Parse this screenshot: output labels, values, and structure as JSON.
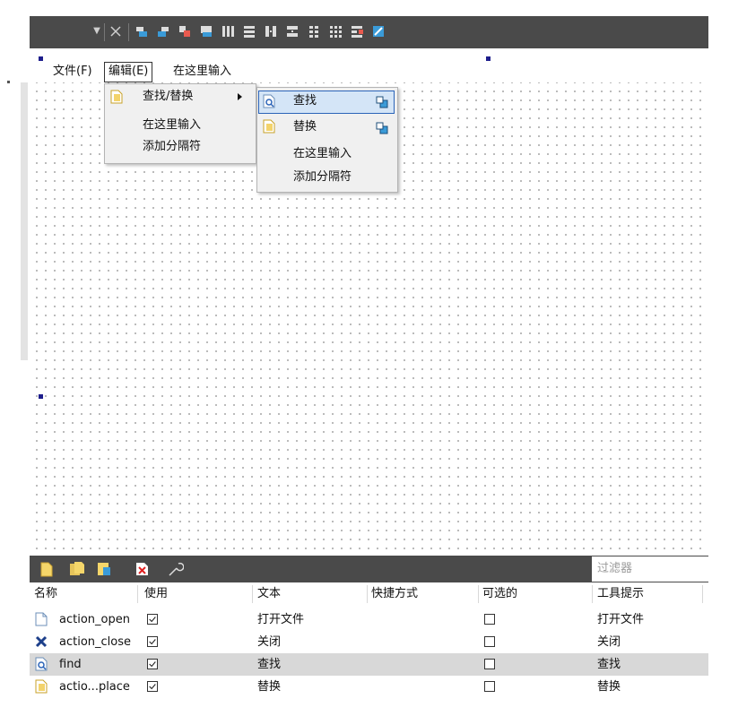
{
  "toolbar": {
    "buttons": [
      "close-x",
      "align-left",
      "align-right",
      "align-top",
      "align-bottom",
      "layout-horizontal",
      "layout-vertical",
      "layout-h-splitter",
      "layout-v-splitter",
      "layout-form",
      "layout-grid",
      "break-layout",
      "adjust-size"
    ]
  },
  "menubar": {
    "file": "文件(F)",
    "edit": "编辑(E)",
    "type_here": "在这里输入"
  },
  "edit_menu": {
    "find_replace": "查找/替换",
    "type_here": "在这里输入",
    "add_separator": "添加分隔符"
  },
  "submenu": {
    "find": "查找",
    "replace": "替换",
    "type_here": "在这里输入",
    "add_separator": "添加分隔符"
  },
  "action_editor": {
    "filter_placeholder": "过滤器",
    "headers": [
      "名称",
      "使用",
      "文本",
      "快捷方式",
      "可选的",
      "工具提示"
    ],
    "rows": [
      {
        "name": "action_open",
        "used": true,
        "text": "打开文件",
        "shortcut": "",
        "checkable": false,
        "tooltip": "打开文件",
        "icon": "file-icon"
      },
      {
        "name": "action_close",
        "used": true,
        "text": "关闭",
        "shortcut": "",
        "checkable": false,
        "tooltip": "关闭",
        "icon": "close-x-icon"
      },
      {
        "name": "find",
        "used": true,
        "text": "查找",
        "shortcut": "",
        "checkable": false,
        "tooltip": "查找",
        "icon": "find-icon"
      },
      {
        "name": "actio...place",
        "used": true,
        "text": "替换",
        "shortcut": "",
        "checkable": false,
        "tooltip": "替换",
        "icon": "replace-icon"
      }
    ]
  }
}
